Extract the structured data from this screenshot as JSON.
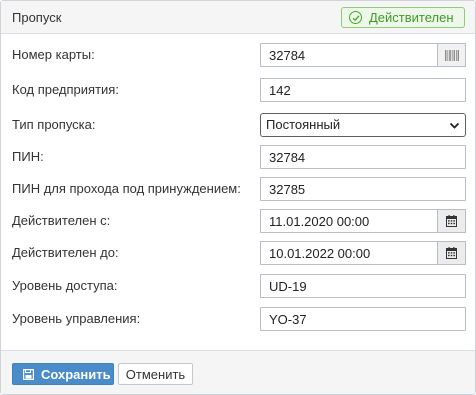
{
  "header": {
    "title": "Пропуск",
    "status": "Действителен"
  },
  "form": {
    "card_number": {
      "label": "Номер карты:",
      "value": "32784"
    },
    "company_code": {
      "label": "Код предприятия:",
      "value": "142"
    },
    "pass_type": {
      "label": "Тип пропуска:",
      "value": "Постоянный"
    },
    "pin": {
      "label": "ПИН:",
      "value": "32784"
    },
    "duress_pin": {
      "label": "ПИН для прохода под принуждением:",
      "value": "32785"
    },
    "valid_from": {
      "label": "Действителен с:",
      "value": "11.01.2020 00:00"
    },
    "valid_to": {
      "label": "Действителен до:",
      "value": "10.01.2022 00:00"
    },
    "access_level": {
      "label": "Уровень доступа:",
      "value": "UD-19"
    },
    "control_level": {
      "label": "Уровень управления:",
      "value": "YO-37"
    }
  },
  "footer": {
    "save_label": "Сохранить",
    "cancel_label": "Отменить"
  },
  "colors": {
    "status_green": "#3f9a25",
    "primary_button": "#4a8cca"
  },
  "icons": {
    "status": "check-circle-icon",
    "card_reader": "barcode-icon",
    "date_picker": "calendar-icon",
    "select": "chevron-down-icon",
    "save": "floppy-disk-icon"
  }
}
